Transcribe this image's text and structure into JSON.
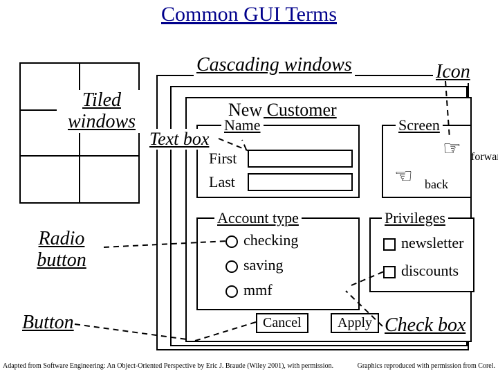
{
  "title": "Common GUI Terms",
  "labels": {
    "tiled": "Tiled windows",
    "cascading": "Cascading windows",
    "icon": "Icon",
    "textbox": "Text box",
    "radio": "Radio button",
    "button": "Button",
    "checkbox": "Check box"
  },
  "form": {
    "header": "New Customer",
    "name": "Name",
    "first": "First",
    "last": "Last",
    "screen": "Screen",
    "forward": "forward",
    "back": "back"
  },
  "account": {
    "legend": "Account type",
    "options": [
      "checking",
      "saving",
      "mmf"
    ]
  },
  "privileges": {
    "legend": "Privileges",
    "options": [
      "newsletter",
      "discounts"
    ]
  },
  "buttons": {
    "cancel": "Cancel",
    "apply": "Apply"
  },
  "credits": {
    "left": "Adapted from Software Engineering: An Object-Oriented Perspective by Eric J. Braude (Wiley 2001), with permission.",
    "right": "Graphics reproduced with permission from Corel."
  }
}
